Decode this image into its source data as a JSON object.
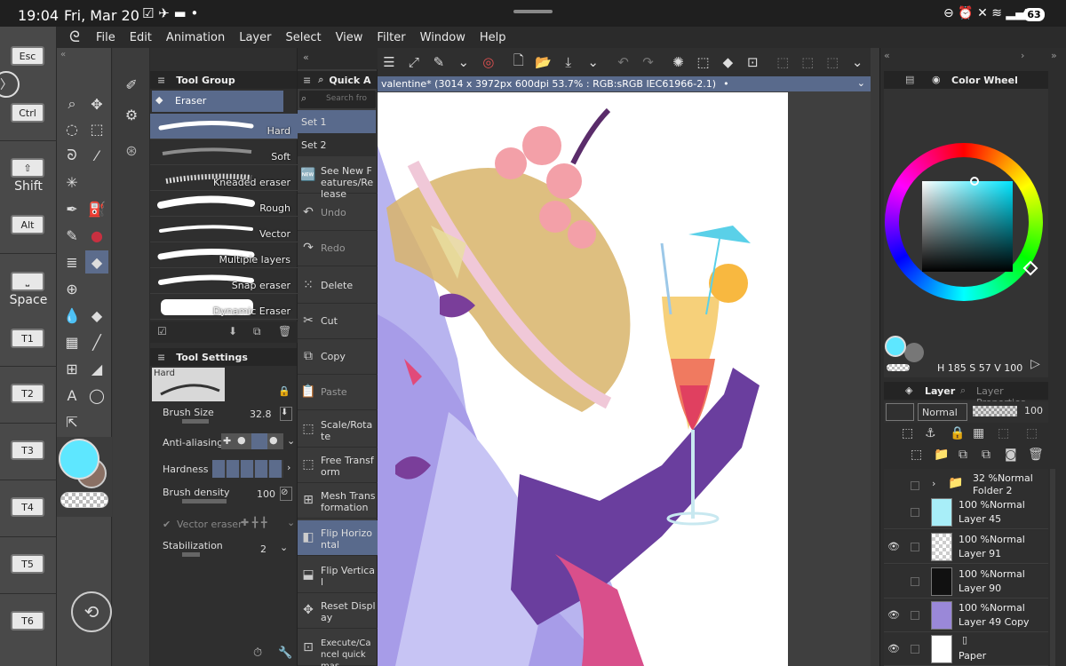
{
  "status": {
    "time": "19:04",
    "date": "Fri, Mar 20",
    "battery": "63"
  },
  "menu": [
    "File",
    "Edit",
    "Animation",
    "Layer",
    "Select",
    "View",
    "Filter",
    "Window",
    "Help"
  ],
  "shortcuts": {
    "esc": "Esc",
    "ctrl": "Ctrl",
    "shift": "Shift",
    "alt": "Alt",
    "space": "Space",
    "t1": "T1",
    "t2": "T2",
    "t3": "T3",
    "t4": "T4",
    "t5": "T5",
    "t6": "T6"
  },
  "tool_group": {
    "title": "Tool Group",
    "current": "Eraser",
    "brushes": [
      "Hard",
      "Soft",
      "Kneaded eraser",
      "Rough",
      "Vector",
      "Multiple layers",
      "Snap eraser",
      "Dynamic Eraser"
    ]
  },
  "tool_settings": {
    "title": "Tool Settings",
    "preview_label": "Hard",
    "brush_size_label": "Brush Size",
    "brush_size": "32.8",
    "antialias_label": "Anti-aliasing",
    "hardness_label": "Hardness",
    "density_label": "Brush density",
    "density": "100",
    "vector_label": "Vector eraser",
    "stab_label": "Stabilization",
    "stab": "2"
  },
  "quick_access": {
    "title": "Quick A",
    "search_placeholder": "Search fro",
    "sets": [
      "Set 1",
      "Set 2"
    ],
    "items": [
      "See New Features/Release",
      "Undo",
      "Redo",
      "Delete",
      "Cut",
      "Copy",
      "Paste",
      "Scale/Rotate",
      "Free Transform",
      "Mesh Transformation",
      "Flip Horizontal",
      "Flip Vertical",
      "Reset Display",
      "Execute/Cancel quick mas"
    ]
  },
  "doc_tab": "valentine* (3014 x 3972px 600dpi 53.7% : RGB:sRGB IEC61966-2.1)",
  "color_wheel": {
    "title": "Color Wheel",
    "h": "185",
    "s": "57",
    "v": "100",
    "h_label": "H",
    "s_label": "S",
    "v_label": "V"
  },
  "layer_panel": {
    "title": "Layer",
    "props_title": "Layer Properties",
    "blend": "Normal",
    "opacity": "100",
    "layers": [
      {
        "pct": "32 %Normal",
        "name": "Folder 2"
      },
      {
        "pct": "100 %Normal",
        "name": "Layer 45"
      },
      {
        "pct": "100 %Normal",
        "name": "Layer 91"
      },
      {
        "pct": "100 %Normal",
        "name": "Layer 90"
      },
      {
        "pct": "100 %Normal",
        "name": "Layer 49 Copy"
      },
      {
        "pct": "",
        "name": "Paper"
      }
    ]
  },
  "colors": {
    "main": "#5ee7ff",
    "accent": "#596a8c"
  }
}
